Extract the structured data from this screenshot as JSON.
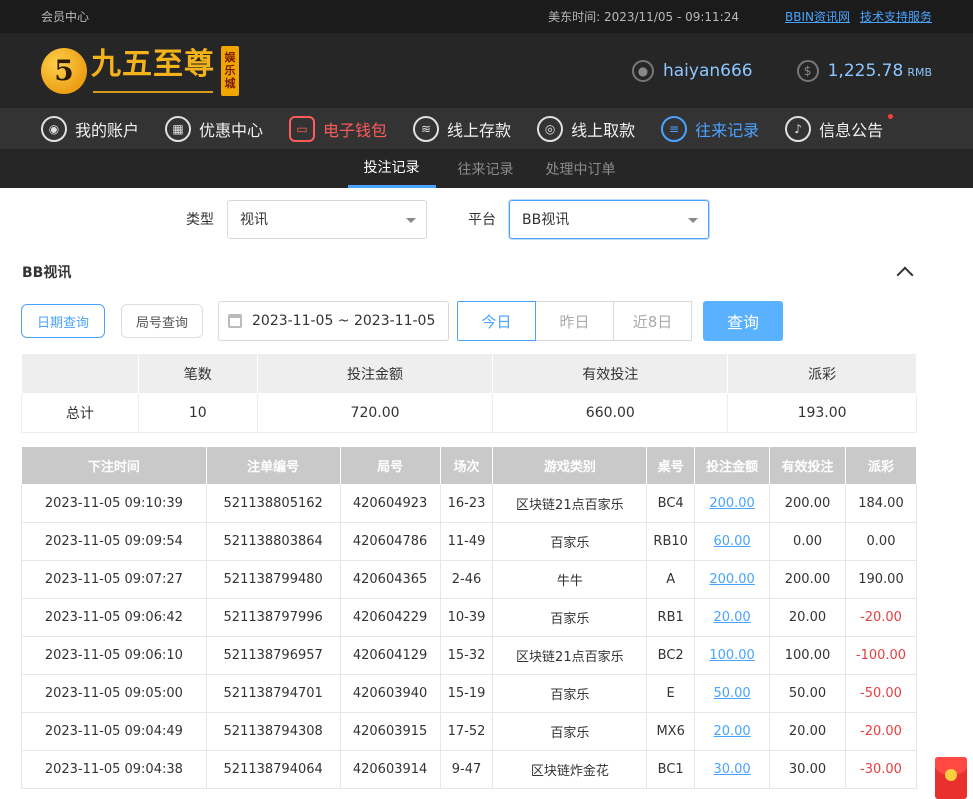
{
  "topbar": {
    "member_center": "会员中心",
    "time_label": "美东时间:",
    "time_value": "2023/11/05 - 09:11:24",
    "link_bbin": "BBIN资讯网",
    "link_support": "技术支持服务"
  },
  "logo": {
    "mark": "5",
    "name": "九五至尊",
    "badge": [
      "娱",
      "乐",
      "城"
    ]
  },
  "user": {
    "username": "haiyan666",
    "balance": "1,225.78",
    "currency": "RMB"
  },
  "nav": [
    {
      "label": "我的账户",
      "icon": "user-icon"
    },
    {
      "label": "优惠中心",
      "icon": "gift-icon"
    },
    {
      "label": "电子钱包",
      "icon": "wallet-icon"
    },
    {
      "label": "线上存款",
      "icon": "deposit-icon"
    },
    {
      "label": "线上取款",
      "icon": "withdraw-icon"
    },
    {
      "label": "往来记录",
      "icon": "records-icon"
    },
    {
      "label": "信息公告",
      "icon": "bell-icon"
    }
  ],
  "subtabs": [
    "投注记录",
    "往来记录",
    "处理中订单"
  ],
  "filters": {
    "type_label": "类型",
    "type_value": "视讯",
    "platform_label": "平台",
    "platform_value": "BB视讯"
  },
  "section": {
    "title": "BB视讯"
  },
  "query": {
    "date_query": "日期查询",
    "round_query": "局号查询",
    "date_range": "2023-11-05 ~ 2023-11-05",
    "today": "今日",
    "yesterday": "昨日",
    "last8": "近8日",
    "search": "查询"
  },
  "summary": {
    "headers": [
      "",
      "笔数",
      "投注金额",
      "有效投注",
      "派彩"
    ],
    "row": [
      "总计",
      "10",
      "720.00",
      "660.00",
      "193.00"
    ]
  },
  "records": {
    "headers": [
      "下注时间",
      "注单编号",
      "局号",
      "场次",
      "游戏类别",
      "桌号",
      "投注金额",
      "有效投注",
      "派彩"
    ],
    "rows": [
      [
        "2023-11-05 09:10:39",
        "521138805162",
        "420604923",
        "16-23",
        "区块链21点百家乐",
        "BC4",
        "200.00",
        "200.00",
        "184.00"
      ],
      [
        "2023-11-05 09:09:54",
        "521138803864",
        "420604786",
        "11-49",
        "百家乐",
        "RB10",
        "60.00",
        "0.00",
        "0.00"
      ],
      [
        "2023-11-05 09:07:27",
        "521138799480",
        "420604365",
        "2-46",
        "牛牛",
        "A",
        "200.00",
        "200.00",
        "190.00"
      ],
      [
        "2023-11-05 09:06:42",
        "521138797996",
        "420604229",
        "10-39",
        "百家乐",
        "RB1",
        "20.00",
        "20.00",
        "-20.00"
      ],
      [
        "2023-11-05 09:06:10",
        "521138796957",
        "420604129",
        "15-32",
        "区块链21点百家乐",
        "BC2",
        "100.00",
        "100.00",
        "-100.00"
      ],
      [
        "2023-11-05 09:05:00",
        "521138794701",
        "420603940",
        "15-19",
        "百家乐",
        "E",
        "50.00",
        "50.00",
        "-50.00"
      ],
      [
        "2023-11-05 09:04:49",
        "521138794308",
        "420603915",
        "17-52",
        "百家乐",
        "MX6",
        "20.00",
        "20.00",
        "-20.00"
      ],
      [
        "2023-11-05 09:04:38",
        "521138794064",
        "420603914",
        "9-47",
        "区块链炸金花",
        "BC1",
        "30.00",
        "30.00",
        "-30.00"
      ]
    ]
  },
  "colors": {
    "accent": "#4aa3ff",
    "negative": "#e64040",
    "gold": "#f4b21b"
  }
}
